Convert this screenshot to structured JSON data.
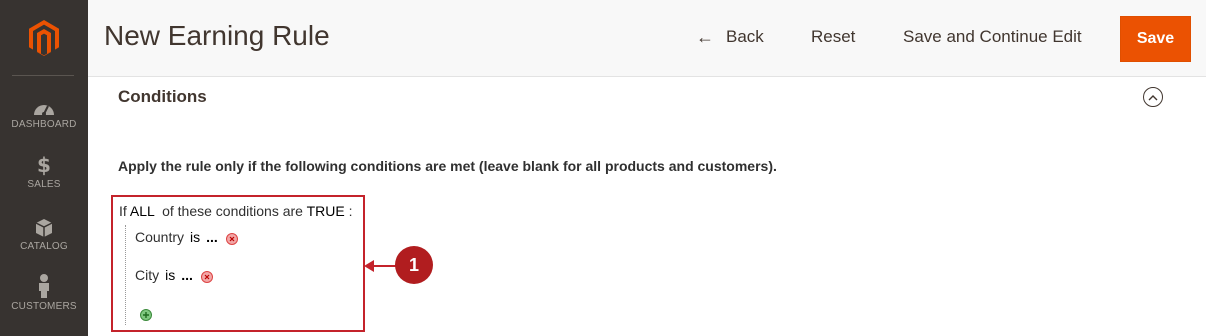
{
  "sidebar": {
    "items": [
      {
        "label": "DASHBOARD",
        "icon": "dashboard-icon"
      },
      {
        "label": "SALES",
        "icon": "dollar-icon",
        "glyph": "$"
      },
      {
        "label": "CATALOG",
        "icon": "cube-icon"
      },
      {
        "label": "CUSTOMERS",
        "icon": "person-icon"
      }
    ]
  },
  "header": {
    "title": "New Earning Rule",
    "back_arrow": "←",
    "back_label": "Back",
    "reset_label": "Reset",
    "save_continue_label": "Save and Continue Edit",
    "save_label": "Save"
  },
  "conditions": {
    "section_title": "Conditions",
    "description": "Apply the rule only if the following conditions are met (leave blank for all products and customers).",
    "head_if": "If",
    "aggregator": "ALL",
    "head_mid": "of these conditions are",
    "value": "TRUE",
    "head_end": ":",
    "rows": [
      {
        "attribute": "Country",
        "operator": "is",
        "value": "..."
      },
      {
        "attribute": "City",
        "operator": "is",
        "value": "..."
      }
    ]
  },
  "callout": {
    "number": "1"
  },
  "colors": {
    "sidebar_bg": "#373330",
    "accent": "#eb5202",
    "highlight": "#c4232b"
  }
}
